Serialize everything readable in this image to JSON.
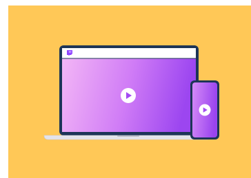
{
  "scene": {
    "description_free": true,
    "colors": {
      "background": "#FFC857",
      "device_frame": "#1D3557",
      "screen_gradient_start": "#F3B3F5",
      "screen_gradient_end": "#A34BF2",
      "browser_bar": "#FFFFFF",
      "laptop_base": "#E6E6EC",
      "play_button": "#FFFFFF",
      "play_glyph": "#A34BF2",
      "logo": "#9147FF"
    },
    "icons": {
      "brand_logo": "twitch-logo-icon",
      "laptop_play": "play-icon",
      "phone_play": "play-icon"
    }
  }
}
